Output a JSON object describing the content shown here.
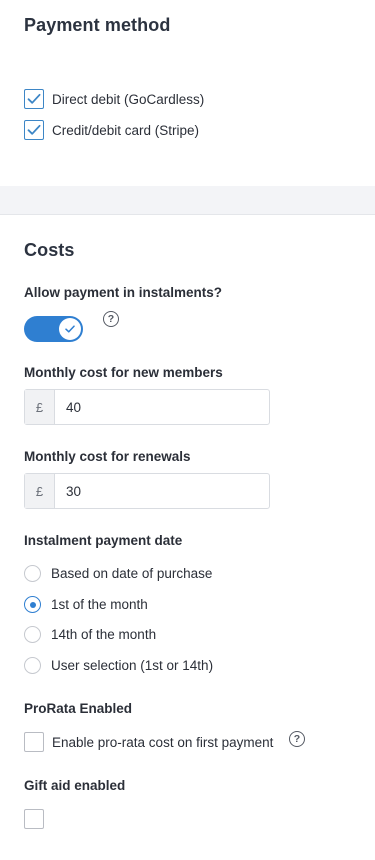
{
  "payment_method": {
    "title": "Payment method",
    "options": [
      {
        "label": "Direct debit (GoCardless)",
        "checked": true
      },
      {
        "label": "Credit/debit card (Stripe)",
        "checked": true
      }
    ]
  },
  "costs": {
    "title": "Costs",
    "instalments": {
      "label": "Allow payment in instalments?",
      "enabled": true,
      "help_icon": "?"
    },
    "new_members": {
      "label": "Monthly cost for new members",
      "currency": "£",
      "value": "40"
    },
    "renewals": {
      "label": "Monthly cost for renewals",
      "currency": "£",
      "value": "30"
    },
    "payment_date": {
      "label": "Instalment payment date",
      "options": [
        {
          "label": "Based on date of purchase",
          "selected": false
        },
        {
          "label": "1st of the month",
          "selected": true
        },
        {
          "label": "14th of the month",
          "selected": false
        },
        {
          "label": "User selection (1st or 14th)",
          "selected": false
        }
      ]
    },
    "prorata": {
      "label": "ProRata Enabled",
      "checkbox_label": "Enable pro-rata cost on first payment",
      "checked": false,
      "help_icon": "?"
    },
    "gift_aid": {
      "label": "Gift aid enabled",
      "checked": false
    }
  },
  "colors": {
    "accent": "#2f7fd1",
    "check": "#3d86c6"
  }
}
